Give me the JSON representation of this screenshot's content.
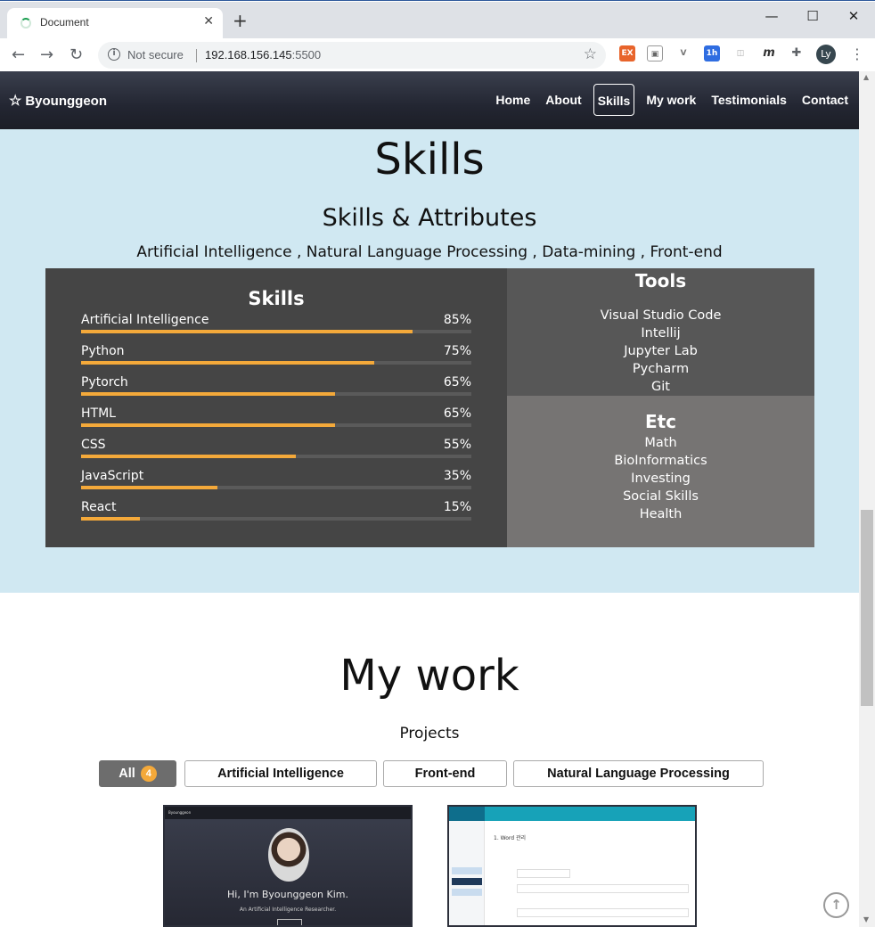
{
  "browser": {
    "tab_title": "Document",
    "tab_close": "✕",
    "new_tab": "+",
    "window_controls": {
      "minimize": "—",
      "maximize": "☐",
      "close": "✕"
    },
    "security_label": "Not secure",
    "url_host": "192.168.156.145",
    "url_port": ":5500",
    "avatar_initials": "Ly",
    "extensions": [
      "EX",
      "▣",
      "V",
      "1h",
      "◫",
      "m",
      "✚"
    ]
  },
  "nav": {
    "brand": "Byounggeon",
    "items": [
      {
        "label": "Home",
        "active": false
      },
      {
        "label": "About",
        "active": false
      },
      {
        "label": "Skills",
        "active": true
      },
      {
        "label": "My work",
        "active": false
      },
      {
        "label": "Testimonials",
        "active": false
      },
      {
        "label": "Contact",
        "active": false
      }
    ]
  },
  "skills_section": {
    "title": "Skills",
    "subtitle": "Skills & Attributes",
    "tagline": "Artificial Intelligence , Natural Language Processing , Data-mining , Front-end",
    "skills_panel_title": "Skills",
    "skills": [
      {
        "name": "Artificial Intelligence",
        "percent_label": "85%",
        "level": 0.85
      },
      {
        "name": "Python",
        "percent_label": "75%",
        "level": 0.75
      },
      {
        "name": "Pytorch",
        "percent_label": "65%",
        "level": 0.65
      },
      {
        "name": "HTML",
        "percent_label": "65%",
        "level": 0.65
      },
      {
        "name": "CSS",
        "percent_label": "55%",
        "level": 0.55
      },
      {
        "name": "JavaScript",
        "percent_label": "35%",
        "level": 0.35
      },
      {
        "name": "React",
        "percent_label": "15%",
        "level": 0.15
      }
    ],
    "tools_title": "Tools",
    "tools": [
      "Visual Studio Code",
      "Intellij",
      "Jupyter Lab",
      "Pycharm",
      "Git"
    ],
    "etc_title": "Etc",
    "etc": [
      "Math",
      "BioInformatics",
      "Investing",
      "Social Skills",
      "Health"
    ]
  },
  "work_section": {
    "title": "My work",
    "subtitle": "Projects",
    "filters": [
      {
        "label": "All",
        "badge": "4",
        "active": true
      },
      {
        "label": "Artificial Intelligence",
        "active": false
      },
      {
        "label": "Front-end",
        "active": false
      },
      {
        "label": "Natural Language Processing",
        "active": false
      }
    ],
    "card1": {
      "brand": "Byounggeon",
      "headline": "Hi, I'm Byounggeon Kim.",
      "tagline": "An Artificial Intelligence Researcher."
    },
    "card2": {
      "title": "1. Word 관리"
    }
  },
  "colors": {
    "accent": "#f4a93a",
    "skills_bg": "#d0e8f2",
    "panel_dark": "#454545",
    "tools_bg": "#575757",
    "etc_bg": "#767473"
  },
  "icons": {
    "back_to_top": "arrow-up-circle-icon"
  }
}
